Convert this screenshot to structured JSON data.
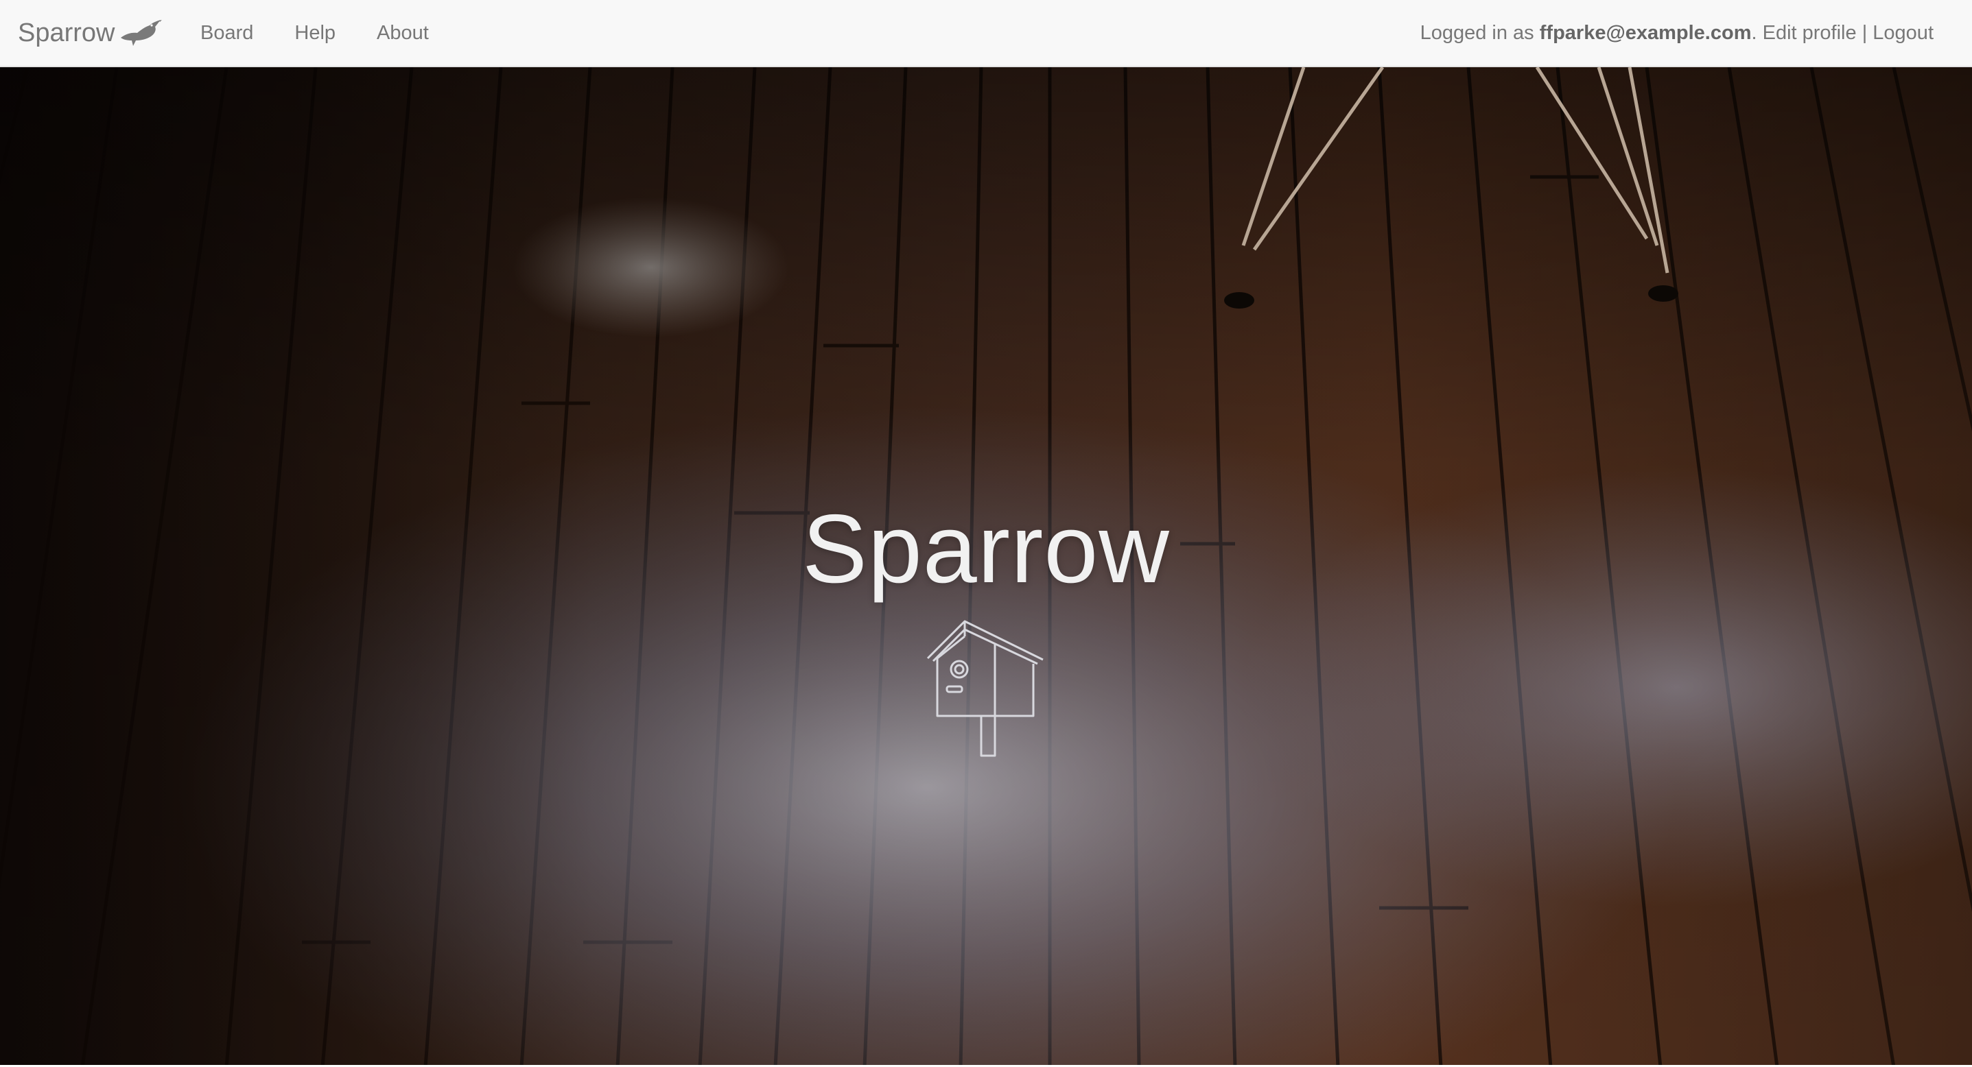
{
  "navbar": {
    "brand": "Sparrow",
    "links": [
      "Board",
      "Help",
      "About"
    ],
    "user": {
      "prefix": "Logged in as",
      "email": "ffparke@example.com",
      "suffix": ".",
      "edit_profile": "Edit profile",
      "separator": "|",
      "logout": "Logout"
    }
  },
  "hero": {
    "title": "Sparrow",
    "icon": "birdhouse-icon"
  },
  "colors": {
    "navbar_bg": "#f8f8f8",
    "nav_text": "#777777",
    "hero_title": "#f1f1f1"
  }
}
